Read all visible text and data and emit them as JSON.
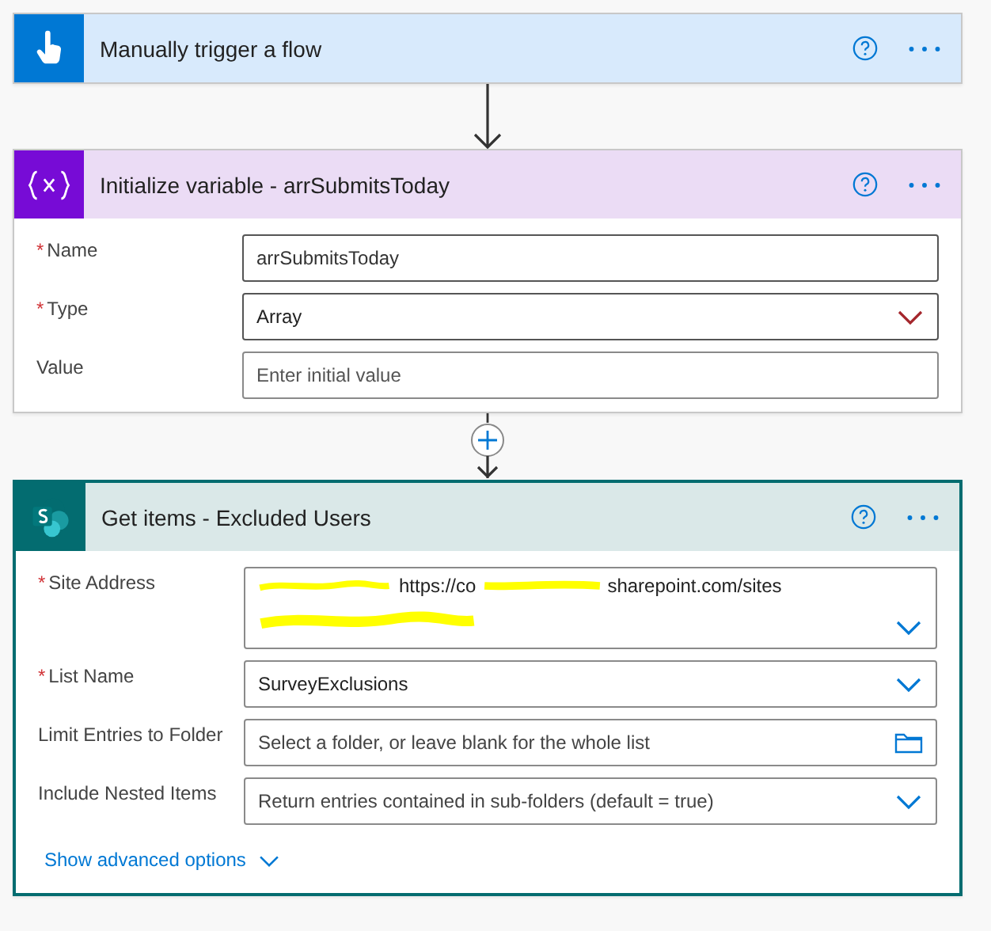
{
  "cards": [
    {
      "kind": "trigger",
      "title": "Manually trigger a flow",
      "color": "#0078d4",
      "selected": false
    },
    {
      "kind": "variable",
      "title": "Initialize variable - arrSubmitsToday",
      "color": "#770bd6",
      "selected": false,
      "fields": [
        {
          "label": "Name",
          "marker": "*",
          "kind": "text",
          "value": "arrSubmitsToday"
        },
        {
          "label": "Type",
          "marker": "*",
          "kind": "dropdown",
          "value": "Array"
        },
        {
          "label": "Value",
          "kind": "text",
          "placeholder": "Enter initial value"
        }
      ]
    },
    {
      "kind": "sharepoint",
      "title": "Get items - Excluded Users",
      "color": "#036c70",
      "selected": true,
      "fields": [
        {
          "label": "Site Address",
          "marker": "*",
          "kind": "redacted-dropdown",
          "lines": [
            [
              {
                "kind": "redaction"
              },
              {
                "kind": "text",
                "text": "https://co"
              },
              {
                "kind": "redaction"
              },
              {
                "kind": "text",
                "text": "sharepoint.com/sites"
              }
            ],
            [
              {
                "kind": "redaction"
              }
            ]
          ]
        },
        {
          "label": "List Name",
          "marker": "*",
          "kind": "dropdown",
          "value": "SurveyExclusions"
        },
        {
          "label": "Limit Entries to Folder",
          "kind": "folder",
          "placeholder": "Select a folder, or leave blank for the whole list"
        },
        {
          "label": "Include Nested Items",
          "kind": "dropdown",
          "placeholder": "Return entries contained in sub-folders (default = true)"
        }
      ],
      "advanced": "Show advanced options"
    }
  ],
  "connectors": [
    {
      "kind": "arrow"
    },
    {
      "kind": "insert"
    }
  ]
}
